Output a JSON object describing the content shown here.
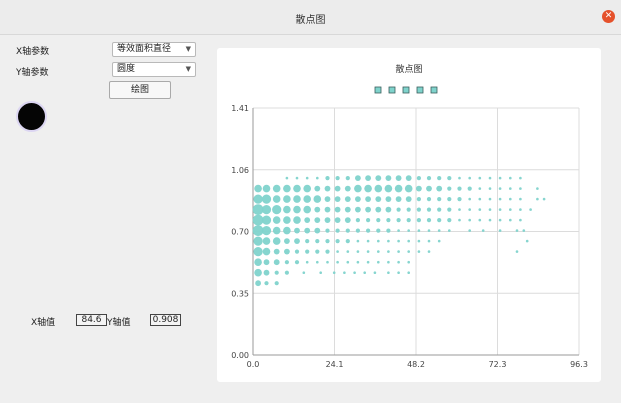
{
  "window": {
    "title": "散点图",
    "close_icon": "close-icon"
  },
  "controls": {
    "x_param_label": "X轴参数",
    "x_param_value": "等效面积直径",
    "y_param_label": "Y轴参数",
    "y_param_value": "圆度",
    "plot_button": "绘图"
  },
  "readout": {
    "x_label": "X轴值",
    "x_value": "84.6",
    "y_label": "Y轴值",
    "y_value": "0.908"
  },
  "chart_data": {
    "type": "scatter",
    "title": "散点图",
    "xlim": [
      0,
      96.3
    ],
    "ylim": [
      0,
      1.41
    ],
    "xticks": [
      "0.0",
      "24.1",
      "48.2",
      "72.3",
      "96.3"
    ],
    "yticks": [
      "0.00",
      "0.35",
      "0.70",
      "1.06",
      "1.41"
    ],
    "grid": true,
    "color": "#7fd3cc",
    "legend_markers": 5,
    "series": [
      {
        "points": [
          [
            1.5,
            0.41,
            3
          ],
          [
            4,
            0.41,
            2
          ],
          [
            7,
            0.41,
            2
          ],
          [
            1.5,
            0.47,
            4
          ],
          [
            4,
            0.47,
            3
          ],
          [
            7,
            0.47,
            2
          ],
          [
            10,
            0.47,
            2
          ],
          [
            15,
            0.47,
            1
          ],
          [
            20,
            0.47,
            1
          ],
          [
            24,
            0.47,
            1
          ],
          [
            27,
            0.47,
            1
          ],
          [
            30,
            0.47,
            1
          ],
          [
            33,
            0.47,
            1
          ],
          [
            36,
            0.47,
            1
          ],
          [
            40,
            0.47,
            1
          ],
          [
            43,
            0.47,
            1
          ],
          [
            46,
            0.47,
            1
          ],
          [
            1.5,
            0.53,
            4
          ],
          [
            4,
            0.53,
            3
          ],
          [
            7,
            0.53,
            3
          ],
          [
            10,
            0.53,
            2
          ],
          [
            13,
            0.53,
            2
          ],
          [
            16,
            0.53,
            1
          ],
          [
            19,
            0.53,
            1
          ],
          [
            22,
            0.53,
            1
          ],
          [
            25,
            0.53,
            1
          ],
          [
            28,
            0.53,
            1
          ],
          [
            31,
            0.53,
            1
          ],
          [
            34,
            0.53,
            1
          ],
          [
            37,
            0.53,
            1
          ],
          [
            40,
            0.53,
            1
          ],
          [
            43,
            0.53,
            1
          ],
          [
            46,
            0.53,
            1
          ],
          [
            1.5,
            0.59,
            5
          ],
          [
            4,
            0.59,
            4
          ],
          [
            7,
            0.59,
            3
          ],
          [
            10,
            0.59,
            3
          ],
          [
            13,
            0.59,
            2
          ],
          [
            16,
            0.59,
            2
          ],
          [
            19,
            0.59,
            2
          ],
          [
            22,
            0.59,
            2
          ],
          [
            25,
            0.59,
            1
          ],
          [
            28,
            0.59,
            1
          ],
          [
            31,
            0.59,
            1
          ],
          [
            34,
            0.59,
            1
          ],
          [
            37,
            0.59,
            1
          ],
          [
            40,
            0.59,
            1
          ],
          [
            43,
            0.59,
            1
          ],
          [
            46,
            0.59,
            1
          ],
          [
            49,
            0.59,
            1
          ],
          [
            52,
            0.59,
            1
          ],
          [
            78,
            0.59,
            1
          ],
          [
            1.5,
            0.65,
            5
          ],
          [
            4,
            0.65,
            4
          ],
          [
            7,
            0.65,
            4
          ],
          [
            10,
            0.65,
            3
          ],
          [
            13,
            0.65,
            3
          ],
          [
            16,
            0.65,
            2
          ],
          [
            19,
            0.65,
            2
          ],
          [
            22,
            0.65,
            2
          ],
          [
            25,
            0.65,
            2
          ],
          [
            28,
            0.65,
            2
          ],
          [
            31,
            0.65,
            1
          ],
          [
            34,
            0.65,
            1
          ],
          [
            37,
            0.65,
            1
          ],
          [
            40,
            0.65,
            1
          ],
          [
            43,
            0.65,
            1
          ],
          [
            46,
            0.65,
            1
          ],
          [
            49,
            0.65,
            1
          ],
          [
            52,
            0.65,
            1
          ],
          [
            55,
            0.65,
            1
          ],
          [
            81,
            0.65,
            1
          ],
          [
            1.5,
            0.71,
            6
          ],
          [
            4,
            0.71,
            5
          ],
          [
            7,
            0.71,
            4
          ],
          [
            10,
            0.71,
            4
          ],
          [
            13,
            0.71,
            3
          ],
          [
            16,
            0.71,
            3
          ],
          [
            19,
            0.71,
            3
          ],
          [
            22,
            0.71,
            2
          ],
          [
            25,
            0.71,
            2
          ],
          [
            28,
            0.71,
            2
          ],
          [
            31,
            0.71,
            2
          ],
          [
            34,
            0.71,
            2
          ],
          [
            37,
            0.71,
            2
          ],
          [
            40,
            0.71,
            2
          ],
          [
            43,
            0.71,
            1
          ],
          [
            46,
            0.71,
            1
          ],
          [
            49,
            0.71,
            1
          ],
          [
            52,
            0.71,
            1
          ],
          [
            55,
            0.71,
            1
          ],
          [
            58,
            0.71,
            1
          ],
          [
            64,
            0.71,
            1
          ],
          [
            68,
            0.71,
            1
          ],
          [
            73,
            0.71,
            1
          ],
          [
            78,
            0.71,
            1
          ],
          [
            80,
            0.71,
            1
          ],
          [
            1.5,
            0.77,
            6
          ],
          [
            4,
            0.77,
            5
          ],
          [
            7,
            0.77,
            4
          ],
          [
            10,
            0.77,
            4
          ],
          [
            13,
            0.77,
            4
          ],
          [
            16,
            0.77,
            3
          ],
          [
            19,
            0.77,
            3
          ],
          [
            22,
            0.77,
            3
          ],
          [
            25,
            0.77,
            3
          ],
          [
            28,
            0.77,
            3
          ],
          [
            31,
            0.77,
            2
          ],
          [
            34,
            0.77,
            2
          ],
          [
            37,
            0.77,
            2
          ],
          [
            40,
            0.77,
            2
          ],
          [
            43,
            0.77,
            2
          ],
          [
            46,
            0.77,
            2
          ],
          [
            49,
            0.77,
            2
          ],
          [
            52,
            0.77,
            2
          ],
          [
            55,
            0.77,
            2
          ],
          [
            58,
            0.77,
            2
          ],
          [
            61,
            0.77,
            1
          ],
          [
            64,
            0.77,
            1
          ],
          [
            67,
            0.77,
            1
          ],
          [
            70,
            0.77,
            1
          ],
          [
            73,
            0.77,
            1
          ],
          [
            76,
            0.77,
            1
          ],
          [
            79,
            0.77,
            1
          ],
          [
            1.5,
            0.83,
            6
          ],
          [
            4,
            0.83,
            5
          ],
          [
            7,
            0.83,
            5
          ],
          [
            10,
            0.83,
            4
          ],
          [
            13,
            0.83,
            4
          ],
          [
            16,
            0.83,
            4
          ],
          [
            19,
            0.83,
            3
          ],
          [
            22,
            0.83,
            3
          ],
          [
            25,
            0.83,
            3
          ],
          [
            28,
            0.83,
            3
          ],
          [
            31,
            0.83,
            3
          ],
          [
            34,
            0.83,
            3
          ],
          [
            37,
            0.83,
            3
          ],
          [
            40,
            0.83,
            3
          ],
          [
            43,
            0.83,
            2
          ],
          [
            46,
            0.83,
            2
          ],
          [
            49,
            0.83,
            2
          ],
          [
            52,
            0.83,
            2
          ],
          [
            55,
            0.83,
            2
          ],
          [
            58,
            0.83,
            2
          ],
          [
            61,
            0.83,
            1
          ],
          [
            64,
            0.83,
            1
          ],
          [
            67,
            0.83,
            1
          ],
          [
            70,
            0.83,
            1
          ],
          [
            73,
            0.83,
            1
          ],
          [
            76,
            0.83,
            1
          ],
          [
            79,
            0.83,
            1
          ],
          [
            82,
            0.83,
            1
          ],
          [
            1.5,
            0.89,
            5
          ],
          [
            4,
            0.89,
            5
          ],
          [
            7,
            0.89,
            4
          ],
          [
            10,
            0.89,
            4
          ],
          [
            13,
            0.89,
            4
          ],
          [
            16,
            0.89,
            4
          ],
          [
            19,
            0.89,
            4
          ],
          [
            22,
            0.89,
            3
          ],
          [
            25,
            0.89,
            3
          ],
          [
            28,
            0.89,
            3
          ],
          [
            31,
            0.89,
            3
          ],
          [
            34,
            0.89,
            3
          ],
          [
            37,
            0.89,
            3
          ],
          [
            40,
            0.89,
            3
          ],
          [
            43,
            0.89,
            3
          ],
          [
            46,
            0.89,
            3
          ],
          [
            49,
            0.89,
            2
          ],
          [
            52,
            0.89,
            2
          ],
          [
            55,
            0.89,
            2
          ],
          [
            58,
            0.89,
            2
          ],
          [
            61,
            0.89,
            2
          ],
          [
            64,
            0.89,
            1
          ],
          [
            67,
            0.89,
            1
          ],
          [
            70,
            0.89,
            1
          ],
          [
            73,
            0.89,
            1
          ],
          [
            76,
            0.89,
            1
          ],
          [
            79,
            0.89,
            1
          ],
          [
            84,
            0.89,
            1
          ],
          [
            86,
            0.89,
            1
          ],
          [
            1.5,
            0.95,
            4
          ],
          [
            4,
            0.95,
            4
          ],
          [
            7,
            0.95,
            4
          ],
          [
            10,
            0.95,
            4
          ],
          [
            13,
            0.95,
            4
          ],
          [
            16,
            0.95,
            4
          ],
          [
            19,
            0.95,
            3
          ],
          [
            22,
            0.95,
            3
          ],
          [
            25,
            0.95,
            3
          ],
          [
            28,
            0.95,
            3
          ],
          [
            31,
            0.95,
            4
          ],
          [
            34,
            0.95,
            4
          ],
          [
            37,
            0.95,
            4
          ],
          [
            40,
            0.95,
            4
          ],
          [
            43,
            0.95,
            4
          ],
          [
            46,
            0.95,
            4
          ],
          [
            49,
            0.95,
            3
          ],
          [
            52,
            0.95,
            3
          ],
          [
            55,
            0.95,
            3
          ],
          [
            58,
            0.95,
            2
          ],
          [
            61,
            0.95,
            2
          ],
          [
            64,
            0.95,
            2
          ],
          [
            67,
            0.95,
            1
          ],
          [
            70,
            0.95,
            1
          ],
          [
            73,
            0.95,
            1
          ],
          [
            76,
            0.95,
            1
          ],
          [
            79,
            0.95,
            1
          ],
          [
            84,
            0.95,
            1
          ],
          [
            10,
            1.01,
            1
          ],
          [
            13,
            1.01,
            1
          ],
          [
            16,
            1.01,
            1
          ],
          [
            19,
            1.01,
            1
          ],
          [
            22,
            1.01,
            2
          ],
          [
            25,
            1.01,
            2
          ],
          [
            28,
            1.01,
            2
          ],
          [
            31,
            1.01,
            3
          ],
          [
            34,
            1.01,
            3
          ],
          [
            37,
            1.01,
            3
          ],
          [
            40,
            1.01,
            3
          ],
          [
            43,
            1.01,
            3
          ],
          [
            46,
            1.01,
            3
          ],
          [
            49,
            1.01,
            2
          ],
          [
            52,
            1.01,
            2
          ],
          [
            55,
            1.01,
            2
          ],
          [
            58,
            1.01,
            2
          ],
          [
            61,
            1.01,
            1
          ],
          [
            64,
            1.01,
            1
          ],
          [
            67,
            1.01,
            1
          ],
          [
            70,
            1.01,
            1
          ],
          [
            73,
            1.01,
            1
          ],
          [
            76,
            1.01,
            1
          ],
          [
            79,
            1.01,
            1
          ]
        ]
      }
    ]
  }
}
